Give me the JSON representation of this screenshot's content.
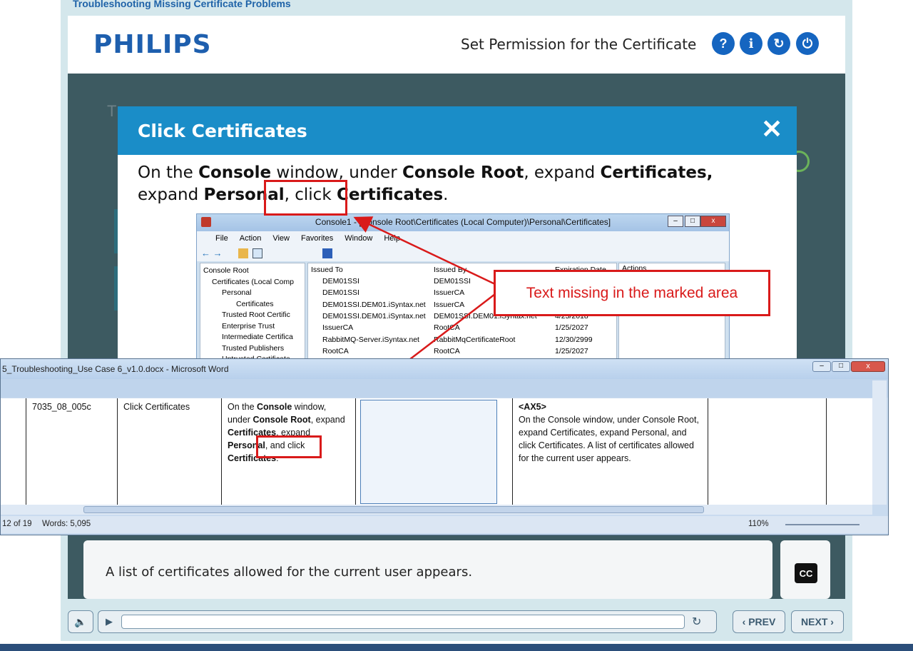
{
  "course": {
    "title": "Troubleshooting Missing Certificate Problems",
    "logo_text": "PHILIPS",
    "slide_title": "Set Permission for the Certificate",
    "header_buttons": {
      "help": "?",
      "info": "i",
      "replay": "↻",
      "exit": "⏻"
    },
    "background_text": "T"
  },
  "modal": {
    "title": "Click Certificates",
    "close": "✕",
    "text_parts": [
      "On the ",
      "Console",
      " window, under ",
      "Console Root",
      ", expand ",
      "Certificates,",
      " expand ",
      "Personal",
      ", click ",
      "Certificates",
      "."
    ]
  },
  "console": {
    "title": "Console1 - [Console Root\\Certificates (Local Computer)\\Personal\\Certificates]",
    "menu": [
      "File",
      "Action",
      "View",
      "Favorites",
      "Window",
      "Help"
    ],
    "tree": [
      "Console Root",
      "Certificates (Local Comp",
      "Personal",
      "Certificates",
      "Trusted Root Certific",
      "Enterprise Trust",
      "Intermediate Certifica",
      "Trusted Publishers",
      "Untrusted Certificate"
    ],
    "columns": [
      "Issued To",
      "Issued By",
      "Expiration Date",
      "Actions"
    ],
    "rows": [
      {
        "issued_to": "DEM01SSI",
        "issued_by": "DEM01SSI",
        "expires": ""
      },
      {
        "issued_to": "DEM01SSI",
        "issued_by": "IssuerCA",
        "expires": ""
      },
      {
        "issued_to": "DEM01SSI.DEM01.iSyntax.net",
        "issued_by": "IssuerCA",
        "expires": ""
      },
      {
        "issued_to": "DEM01SSI.DEM01.iSyntax.net",
        "issued_by": "DEM01SSI.DEM01.iSyntax.net",
        "expires": "4/25/2018"
      },
      {
        "issued_to": "IssuerCA",
        "issued_by": "RootCA",
        "expires": "1/25/2027"
      },
      {
        "issued_to": "RabbitMQ-Server.iSyntax.net",
        "issued_by": "RabbitMqCertificateRoot",
        "expires": "12/30/2999"
      },
      {
        "issued_to": "RootCA",
        "issued_by": "RootCA",
        "expires": "1/25/2027"
      }
    ]
  },
  "annotation": {
    "callout": "Text missing in the marked area"
  },
  "word": {
    "title": "5_Troubleshooting_Use Case 6_v1.0.docx - Microsoft Word",
    "row": {
      "id": "7035_08_005c",
      "name": "Click Certificates",
      "text_parts": [
        "On the ",
        "Console",
        " window, under ",
        "Console Root",
        ", expand ",
        "Certificates",
        ", expand ",
        "Personal",
        ", and click ",
        "Certificates",
        "."
      ],
      "audio_tag": "<AX5>",
      "audio_text": "On the Console window, under Console Root, expand Certificates, expand Personal, and click Certificates.  A list of certificates allowed for the current user appears."
    },
    "status": {
      "page": "12 of 19",
      "words": "Words: 5,095",
      "zoom": "110%"
    }
  },
  "transcript": {
    "text": "A list of certificates allowed for the current user appears.",
    "cc_label": "CC"
  },
  "controls": {
    "prev": "PREV",
    "next": "NEXT"
  },
  "colors": {
    "brand": "#1e5fae",
    "modal_header": "#1a8dc8",
    "annotation": "#d91a1a"
  }
}
